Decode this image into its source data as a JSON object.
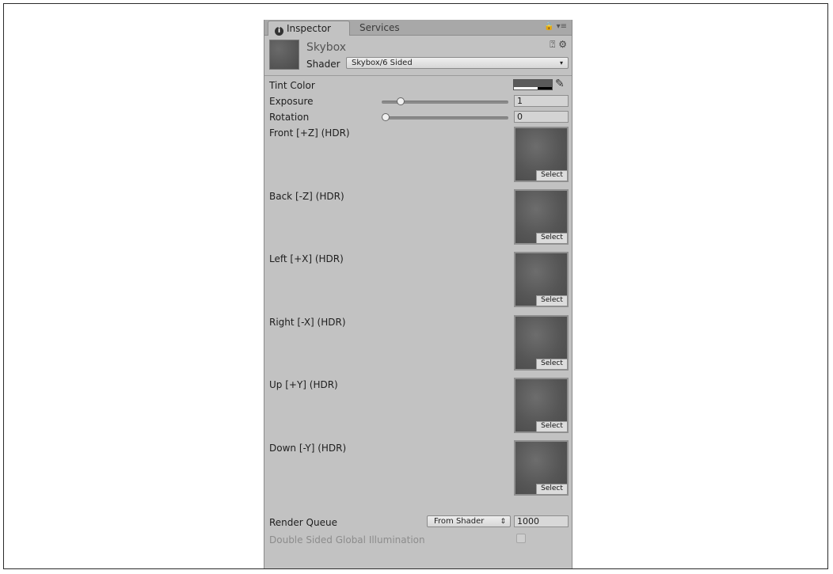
{
  "tabs": [
    {
      "label": "Inspector"
    },
    {
      "label": "Services"
    }
  ],
  "tab_tools": "🔒 ▾≡",
  "material": {
    "name": "Skybox",
    "shader_label": "Shader",
    "shader_value": "Skybox/6 Sided"
  },
  "properties": {
    "tint_color": {
      "label": "Tint Color"
    },
    "exposure": {
      "label": "Exposure",
      "value": "1"
    },
    "rotation": {
      "label": "Rotation",
      "value": "0"
    }
  },
  "textures": [
    {
      "label": "Front [+Z]   (HDR)",
      "button": "Select"
    },
    {
      "label": "Back [-Z]   (HDR)",
      "button": "Select"
    },
    {
      "label": "Left [+X]   (HDR)",
      "button": "Select"
    },
    {
      "label": "Right [-X]   (HDR)",
      "button": "Select"
    },
    {
      "label": "Up [+Y]   (HDR)",
      "button": "Select"
    },
    {
      "label": "Down [-Y]   (HDR)",
      "button": "Select"
    }
  ],
  "render_queue": {
    "label": "Render Queue",
    "mode": "From Shader",
    "value": "1000"
  },
  "double_sided_gi": {
    "label": "Double Sided Global Illumination"
  }
}
